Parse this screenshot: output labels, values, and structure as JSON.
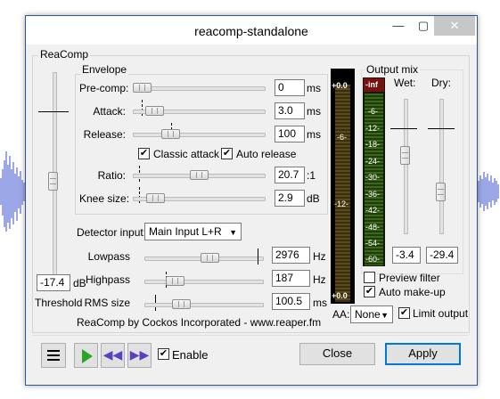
{
  "window": {
    "title": "reacomp-standalone"
  },
  "group_label": "ReaComp",
  "envelope": {
    "label": "Envelope",
    "precomp": {
      "label": "Pre-comp:",
      "value": "0",
      "unit": "ms"
    },
    "attack": {
      "label": "Attack:",
      "value": "3.0",
      "unit": "ms"
    },
    "release": {
      "label": "Release:",
      "value": "100",
      "unit": "ms"
    },
    "classic_attack": {
      "label": "Classic attack",
      "checked": true
    },
    "auto_release": {
      "label": "Auto release",
      "checked": true
    },
    "ratio": {
      "label": "Ratio:",
      "value": "20.7",
      "unit": ":1"
    },
    "knee": {
      "label": "Knee size:",
      "value": "2.9",
      "unit": "dB"
    }
  },
  "threshold": {
    "label": "Threshold",
    "value": "-17.4",
    "unit": "dB"
  },
  "detector": {
    "label": "Detector input:",
    "selected": "Main Input L+R"
  },
  "lowpass": {
    "label": "Lowpass",
    "value": "2976",
    "unit": "Hz"
  },
  "highpass": {
    "label": "Highpass",
    "value": "187",
    "unit": "Hz"
  },
  "rms": {
    "label": "RMS size",
    "value": "100.5",
    "unit": "ms"
  },
  "credit": "ReaComp by Cockos Incorporated - www.reaper.fm",
  "meter": {
    "top": "+0.0",
    "mid1": "-6-",
    "mid2": "-12-",
    "bottom": "+0.0"
  },
  "output_mix": {
    "label": "Output mix",
    "gr_top": "-inf",
    "gr_ticks": [
      "-6-",
      "-12-",
      "-18-",
      "-24-",
      "-30-",
      "-36-",
      "-42-",
      "-48-",
      "-54-",
      "-60-"
    ],
    "wet": {
      "label": "Wet:",
      "value": "-3.4"
    },
    "dry": {
      "label": "Dry:",
      "value": "-29.4"
    },
    "preview_filter": {
      "label": "Preview filter",
      "checked": false
    },
    "auto_makeup": {
      "label": "Auto make-up",
      "checked": true
    }
  },
  "aa": {
    "label": "AA:",
    "selected": "None"
  },
  "limit_output": {
    "label": "Limit output",
    "checked": true
  },
  "bottom": {
    "enable": {
      "label": "Enable",
      "checked": true
    },
    "close_label": "Close",
    "apply_label": "Apply"
  },
  "colors": {
    "accent": "#0078d7",
    "wave": "#3a4fd0",
    "meter_green": "#4a8a1e",
    "meter_red": "#7a1010"
  },
  "check_mark": "✔"
}
